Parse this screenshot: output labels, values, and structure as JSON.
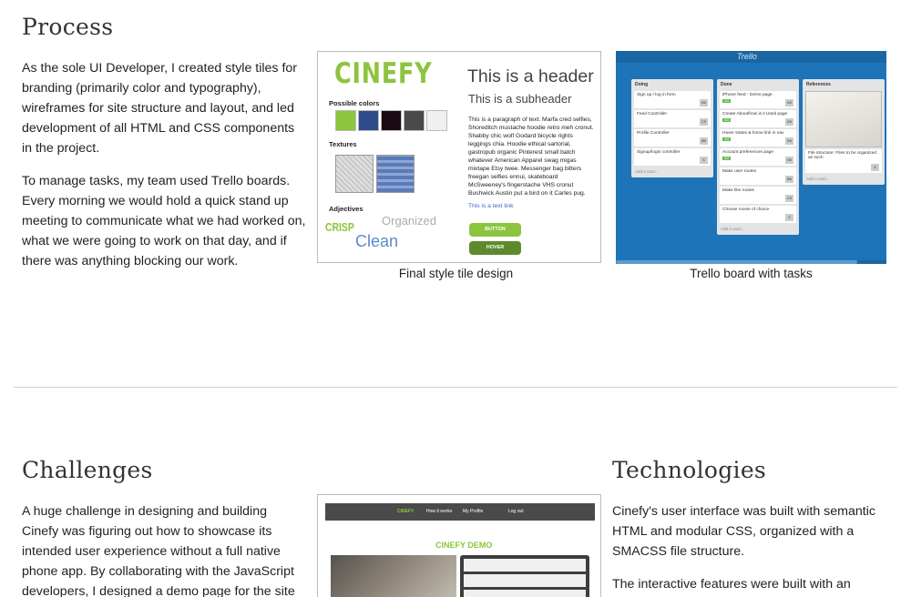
{
  "process": {
    "heading": "Process",
    "paragraphs": [
      "As the sole UI Developer, I created style tiles for branding (primarily color and typography), wireframes for site structure and layout, and led development of all HTML and CSS components in the project.",
      "To manage tasks, my team used Trello boards. Every morning we would hold a quick stand up meeting to communicate what we had worked on, what we were going to work on that day, and if there was anything blocking our work."
    ],
    "captions": [
      "Final style tile design",
      "Trello board with tasks"
    ]
  },
  "style_tile": {
    "logo": "CINEFY",
    "possible_colors_label": "Possible colors",
    "textures_label": "Textures",
    "adjectives_label": "Adjectives",
    "header": "This is a header",
    "subheader": "This is a subheader",
    "paragraph": "This is a paragraph of text. Marfa cred selfies, Shoreditch mustache hoodie retro meh cronut. Shabby chic wolf Godard bicycle rights leggings chia. Hoodie ethical sartorial, gastropub organic Pinterest small batch whatever American Apparel swag migas mixtape Etsy twee. Messenger bag bitters freegan selfies ennui, skateboard McSweeney's fingerstache VHS cronut Bushwick Austin put a bird on it Carles pug.",
    "text_link": "This is a text link",
    "button_label": "BUTTON",
    "hover_label": "HOVER",
    "adjectives": [
      "CRISP",
      "Organized",
      "Clean"
    ],
    "colors": [
      "#8cc43e",
      "#2e4b8a",
      "#1a0a14",
      "#4a4a4a",
      "#f0f0f0"
    ]
  },
  "trello": {
    "logo": "Trello",
    "lists": [
      {
        "title": "Doing",
        "cards": [
          {
            "text": "Sign up / log in form",
            "badge": "KB",
            "label": ""
          },
          {
            "text": "Feed Controller",
            "badge": "CS",
            "label": ""
          },
          {
            "text": "Profile Controller",
            "badge": "BB",
            "label": ""
          },
          {
            "text": "Signup/login controller",
            "badge": "S",
            "label": ""
          }
        ],
        "add": "Add a card..."
      },
      {
        "title": "Done",
        "cards": [
          {
            "text": "iPhone feed - Demo page",
            "badge": "KB",
            "label": "4/4"
          },
          {
            "text": "Create About/how is it Used page",
            "badge": "KB",
            "label": "4/4"
          },
          {
            "text": "Hover states & home link in nav",
            "badge": "KB",
            "label": "4/4"
          },
          {
            "text": "Account preferences page",
            "badge": "KB",
            "label": "4/4"
          },
          {
            "text": "Make user routes",
            "badge": "BB",
            "label": ""
          },
          {
            "text": "Make like routes",
            "badge": "CS",
            "label": ""
          },
          {
            "text": "Choose movie of choice",
            "badge": "S",
            "label": ""
          }
        ],
        "add": "Add a card..."
      },
      {
        "title": "References",
        "cards": [
          {
            "text": "File structure: Files to be organized as such",
            "badge": "S",
            "label": ""
          }
        ],
        "add": "Add a card..."
      }
    ]
  },
  "challenges": {
    "heading": "Challenges",
    "paragraph": "A huge challenge in designing and building Cinefy was figuring out how to showcase its intended user experience without a full native phone app. By collaborating with the JavaScript developers, I designed a demo page for the site that clearly"
  },
  "demo": {
    "nav_logo": "CINEFY",
    "nav_items": [
      "How it works",
      "My Profile",
      "Log out"
    ],
    "title": "CINEFY DEMO"
  },
  "technologies": {
    "heading": "Technologies",
    "paragraphs": [
      "Cinefy's user interface was built with semantic HTML and modular CSS, organized with a SMACSS file structure.",
      "The interactive features were built with an"
    ]
  }
}
